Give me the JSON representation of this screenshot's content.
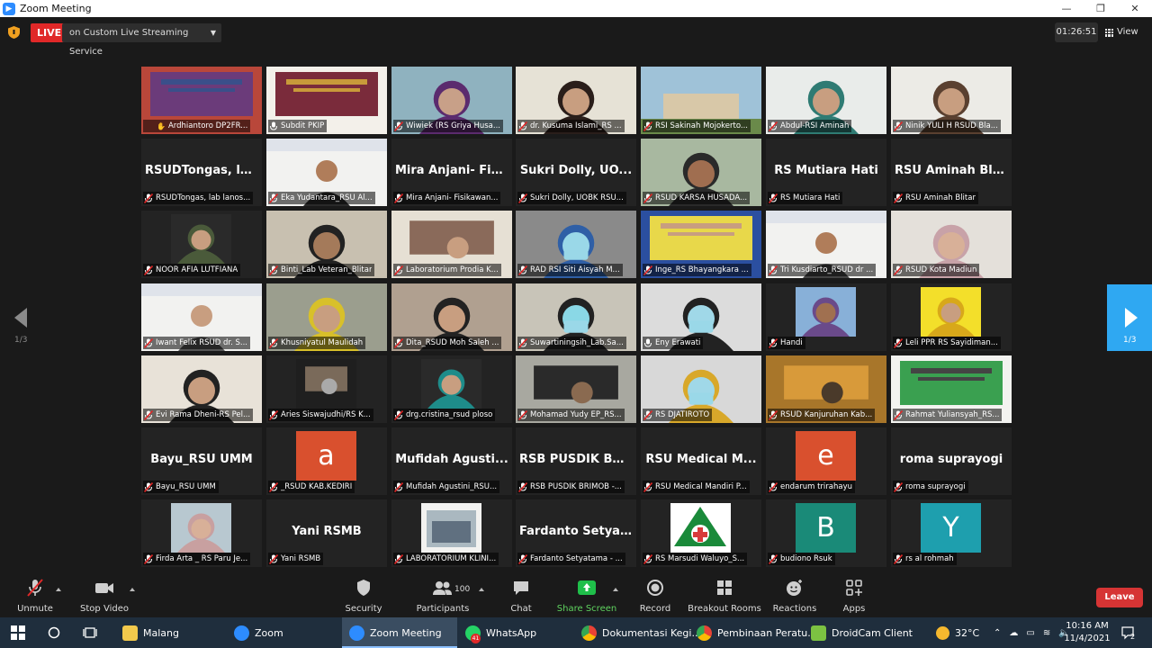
{
  "window": {
    "title": "Zoom Meeting",
    "minimize": "—",
    "maximize": "❐",
    "close": "✕"
  },
  "topbar": {
    "live_label": "LIVE",
    "streaming_label": "on Custom Live Streaming Service",
    "timer": "01:26:51",
    "view_label": "View"
  },
  "pager": {
    "left_label": "1/3",
    "right_label": "1/3"
  },
  "tiles": [
    {
      "name": "Ardhiantoro DP2FR...",
      "scene": "slide",
      "muted": false,
      "active": true
    },
    {
      "name": "Subdit PKIP",
      "scene": "stage",
      "muted": false
    },
    {
      "name": "Wiwiek (RS Griya Husa...",
      "scene": "hijab-purple",
      "muted": true
    },
    {
      "name": "dr. Kusuma Islami_RS ...",
      "scene": "person-dark-hair",
      "muted": true
    },
    {
      "name": "RSI Sakinah Mojokerto...",
      "scene": "building",
      "muted": true
    },
    {
      "name": "Abdul-RSI Aminah",
      "scene": "nurse",
      "muted": true
    },
    {
      "name": "Ninik YULI H RSUD Bla...",
      "scene": "hijab-brown",
      "muted": true
    },
    {
      "name": "RSUDTongas, lab lanos...",
      "big": "RSUDTongas, la...",
      "muted": true
    },
    {
      "name": "Eka Yudantara_RSU Al...",
      "scene": "slide-man",
      "muted": true
    },
    {
      "name": "Mira Anjani- Fisikawan...",
      "big": "Mira Anjani- Fis...",
      "muted": true
    },
    {
      "name": "Sukri Dolly, UOBK RSU...",
      "big": "Sukri Dolly, UO...",
      "muted": true
    },
    {
      "name": "RSUD KARSA HUSADA...",
      "scene": "man-glasses",
      "muted": true
    },
    {
      "name": "RS Mutiara Hati",
      "big": "RS Mutiara Hati",
      "muted": true
    },
    {
      "name": "RSU Aminah Blitar",
      "big": "RSU Aminah Bli...",
      "muted": true
    },
    {
      "name": "NOOR AFIA LUTFIANA",
      "scene": "hijab-small",
      "muted": true
    },
    {
      "name": "Binti_Lab Veteran_Blitar",
      "scene": "hijab-dark",
      "muted": true
    },
    {
      "name": "Laboratorium Prodia K...",
      "scene": "lab",
      "muted": true
    },
    {
      "name": "RAD RSI Siti Aisyah M...",
      "scene": "hijab-mask",
      "muted": true
    },
    {
      "name": "Inge_RS Bhayangkara ...",
      "scene": "survey",
      "muted": true
    },
    {
      "name": "Tri Kusdiarto_RSUD dr ...",
      "scene": "slide-man2",
      "muted": true
    },
    {
      "name": "RSUD Kota Madiun",
      "scene": "hijab-pink",
      "muted": true
    },
    {
      "name": "Iwant Felix RSUD dr. S...",
      "scene": "slide-man3",
      "muted": true
    },
    {
      "name": "Khusniyatul Maulidah",
      "scene": "hijab-yellow",
      "muted": true
    },
    {
      "name": "Dita_RSUD Moh Saleh ...",
      "scene": "hijab-shelf",
      "muted": true
    },
    {
      "name": "Suwartiningsih_Lab.Sa...",
      "scene": "woman-mask",
      "muted": true
    },
    {
      "name": "Eny Erawati",
      "scene": "headset",
      "muted": false
    },
    {
      "name": "Handi",
      "scene": "handi",
      "muted": true
    },
    {
      "name": "Leli PPR RS Sayidiman...",
      "scene": "hijab-yellowbg",
      "muted": true
    },
    {
      "name": "Evi Rama Dheni-RS Pel...",
      "scene": "hijab-light",
      "muted": true
    },
    {
      "name": "Aries Siswajudhi/RS K...",
      "scene": "small-room",
      "muted": true
    },
    {
      "name": "drg.cristina_rsud ploso",
      "scene": "hijab-teal",
      "muted": true
    },
    {
      "name": "Mohamad Yudy EP_RS...",
      "scene": "wall",
      "muted": true
    },
    {
      "name": "RS DJATIROTO",
      "scene": "hijab-mask2",
      "muted": true
    },
    {
      "name": "RSUD Kanjuruhan Kab...",
      "scene": "room-orange",
      "muted": true
    },
    {
      "name": "Rahmat Yuliansyah_RS...",
      "scene": "webinar",
      "muted": true
    },
    {
      "name": "Bayu_RSU UMM",
      "big": "Bayu_RSU UMM",
      "muted": true
    },
    {
      "name": "_RSUD KAB.KEDIRI",
      "letter": "a",
      "letter_color": "#d9502e",
      "muted": true
    },
    {
      "name": "Mufidah Agustini_RSU...",
      "big": "Mufidah Agusti...",
      "muted": true
    },
    {
      "name": "RSB PUSDIK BRIMOB -...",
      "big": "RSB PUSDIK BRI...",
      "muted": true
    },
    {
      "name": "RSU Medical Mandiri P...",
      "big": "RSU Medical M...",
      "muted": true
    },
    {
      "name": "endarum trirahayu",
      "letter": "e",
      "letter_color": "#d9502e",
      "muted": true
    },
    {
      "name": "roma suprayogi",
      "big": "roma suprayogi",
      "muted": true
    },
    {
      "name": "Firda Arta _ RS Paru Je...",
      "scene": "hijab-outdoor",
      "muted": true
    },
    {
      "name": "Yani RSMB",
      "big": "Yani RSMB",
      "muted": true
    },
    {
      "name": "LABORATORIUM KLINI...",
      "scene": "storefront",
      "muted": true
    },
    {
      "name": "Fardanto Setyatama - ...",
      "big": "Fardanto Setyat...",
      "muted": true
    },
    {
      "name": "RS Marsudi Waluyo_S...",
      "scene": "logo-cross",
      "muted": true
    },
    {
      "name": "budiono Rsuk",
      "letter": "B",
      "letter_color": "#1a8a78",
      "muted": true
    },
    {
      "name": "rs al rohmah",
      "letter": "Y",
      "letter_color": "#1e9fae",
      "muted": true
    }
  ],
  "toolbar": {
    "unmute": "Unmute",
    "stop_video": "Stop Video",
    "security": "Security",
    "participants": "Participants",
    "participant_count": "100",
    "chat": "Chat",
    "share_screen": "Share Screen",
    "record": "Record",
    "breakout_rooms": "Breakout Rooms",
    "reactions": "Reactions",
    "apps": "Apps",
    "leave": "Leave"
  },
  "taskbar": {
    "items": [
      {
        "label": "Malang",
        "color": "#f2c94c"
      },
      {
        "label": "Zoom",
        "color": "#2d8cff"
      },
      {
        "label": "Zoom Meeting",
        "color": "#2d8cff"
      },
      {
        "label": "WhatsApp",
        "color": "#25d366"
      },
      {
        "label": "Dokumentasi Kegi...",
        "color": "#e6e6e6"
      },
      {
        "label": "Pembinaan Peratu...",
        "color": "#e6e6e6"
      },
      {
        "label": "DroidCam Client",
        "color": "#7cc242"
      }
    ],
    "whatsapp_badge": "41",
    "temperature": "32°C",
    "time": "10:16 AM",
    "date": "11/4/2021",
    "notification_count": "2"
  },
  "colors": {
    "accent": "#2fa8f2",
    "live": "#e02828",
    "leave": "#d63434",
    "share_green": "#1fbf4a",
    "active_border": "#e8e85a"
  }
}
